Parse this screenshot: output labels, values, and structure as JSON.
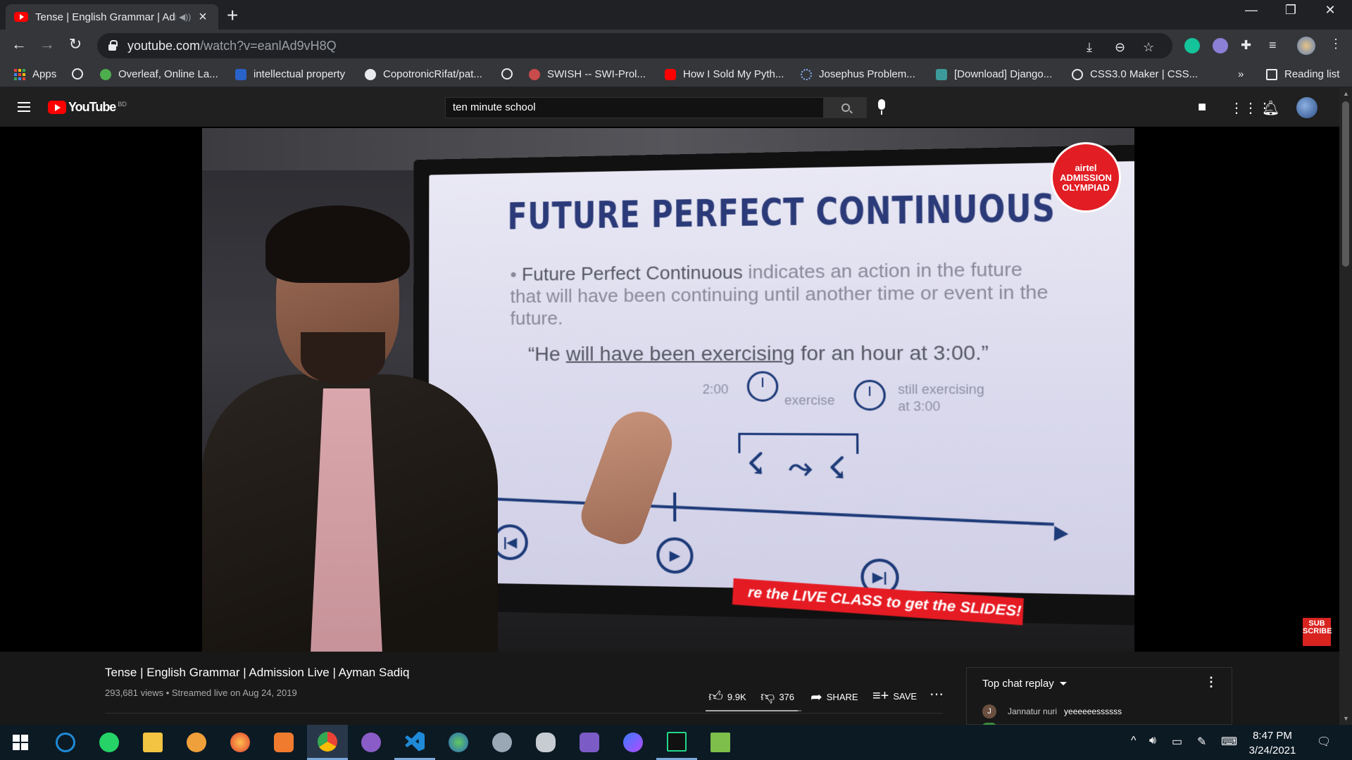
{
  "browser": {
    "tab_title": "Tense | English Grammar | Admission Live | Ayman Sadiq",
    "url_host": "youtube.com",
    "url_path": "/watch?v=eanlAd9vH8Q",
    "bookmarks": [
      "Apps",
      "Overleaf, Online La...",
      "intellectual property",
      "CopotronicRifat/pat...",
      "SWISH -- SWI-Prol...",
      "How I Sold My Pyth...",
      "Josephus Problem...",
      "[Download] Django...",
      "CSS3.0 Maker | CSS..."
    ],
    "overflow_label": "»",
    "reading_list": "Reading list"
  },
  "youtube": {
    "logo_text": "YouTube",
    "region": "BD",
    "search_value": "ten minute school"
  },
  "video": {
    "slide_title": "FUTURE PERFECT CONTINUOUS",
    "bullet_lead": "Future Perfect Continuous",
    "bullet_rest": " indicates an action in the future that will have been continuing until another time or event in the future.",
    "quote_start": "“He ",
    "quote_underlined": "will have been exercising",
    "quote_end": " for an hour at 3:00.”",
    "label_time1": "2:00",
    "label_exercise": "exercise",
    "label_still": "still exercising",
    "label_at": "at 3:00",
    "banner": "re the LIVE CLASS to get the SLIDES!",
    "badge_brand": "airtel",
    "badge_line1": "ADMISSION",
    "badge_line2": "OLYMPIAD",
    "sub_logo": "SUB SCRIBE"
  },
  "info": {
    "title": "Tense | English Grammar | Admission Live | Ayman Sadiq",
    "meta": "293,681 views • Streamed live on Aug 24, 2019",
    "likes": "9.9K",
    "dislikes": "376",
    "share": "SHARE",
    "save": "SAVE",
    "like_ratio": 0.96
  },
  "chat": {
    "header": "Top chat replay",
    "messages": [
      {
        "initial": "J",
        "author": "Jannatur nuri",
        "text": "yeeeeeessssss"
      }
    ]
  },
  "taskbar": {
    "time": "8:47 PM",
    "date": "3/24/2021"
  },
  "colors": {
    "youtube_red": "#ff0000",
    "slide_navy": "#1d3a78",
    "banner_red": "#e51b23"
  }
}
